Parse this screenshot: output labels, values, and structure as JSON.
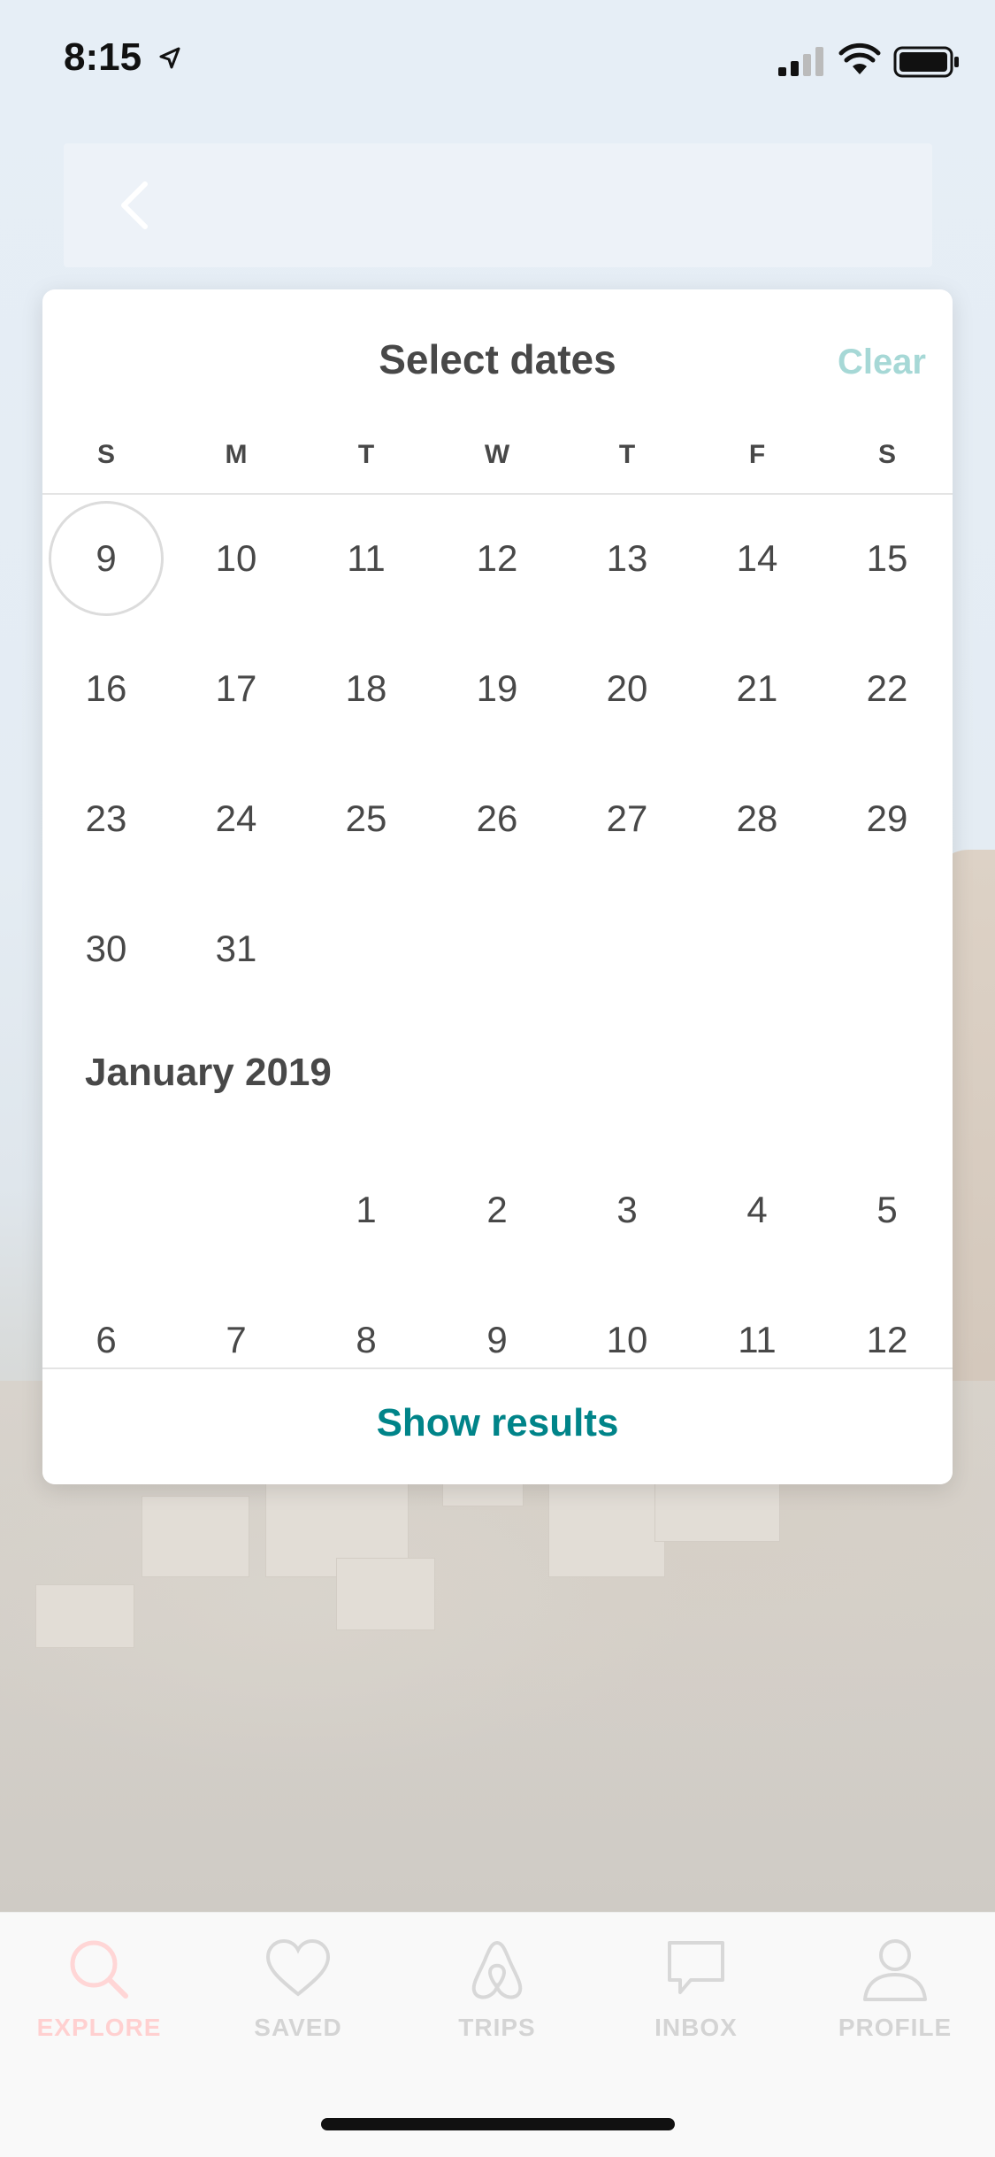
{
  "status_bar": {
    "time": "8:15"
  },
  "calendar": {
    "title": "Select dates",
    "clear_label": "Clear",
    "weekdays": [
      "S",
      "M",
      "T",
      "W",
      "T",
      "F",
      "S"
    ],
    "current_month_rows": [
      [
        "9",
        "10",
        "11",
        "12",
        "13",
        "14",
        "15"
      ],
      [
        "16",
        "17",
        "18",
        "19",
        "20",
        "21",
        "22"
      ],
      [
        "23",
        "24",
        "25",
        "26",
        "27",
        "28",
        "29"
      ],
      [
        "30",
        "31"
      ]
    ],
    "next_month": {
      "label": "January 2019",
      "rows": [
        [
          "",
          "",
          "1",
          "2",
          "3",
          "4",
          "5"
        ],
        [
          "6",
          "7",
          "8",
          "9",
          "10",
          "11",
          "12"
        ]
      ]
    },
    "show_results_label": "Show results"
  },
  "tabs": [
    {
      "label": "EXPLORE",
      "icon": "search-icon"
    },
    {
      "label": "SAVED",
      "icon": "heart-icon"
    },
    {
      "label": "TRIPS",
      "icon": "airbnb-logo-icon"
    },
    {
      "label": "INBOX",
      "icon": "chat-bubble-icon"
    },
    {
      "label": "PROFILE",
      "icon": "person-icon"
    }
  ],
  "colors": {
    "accent": "#008489",
    "clear": "#a6d8d6",
    "explore_active": "#ff5a5f"
  }
}
